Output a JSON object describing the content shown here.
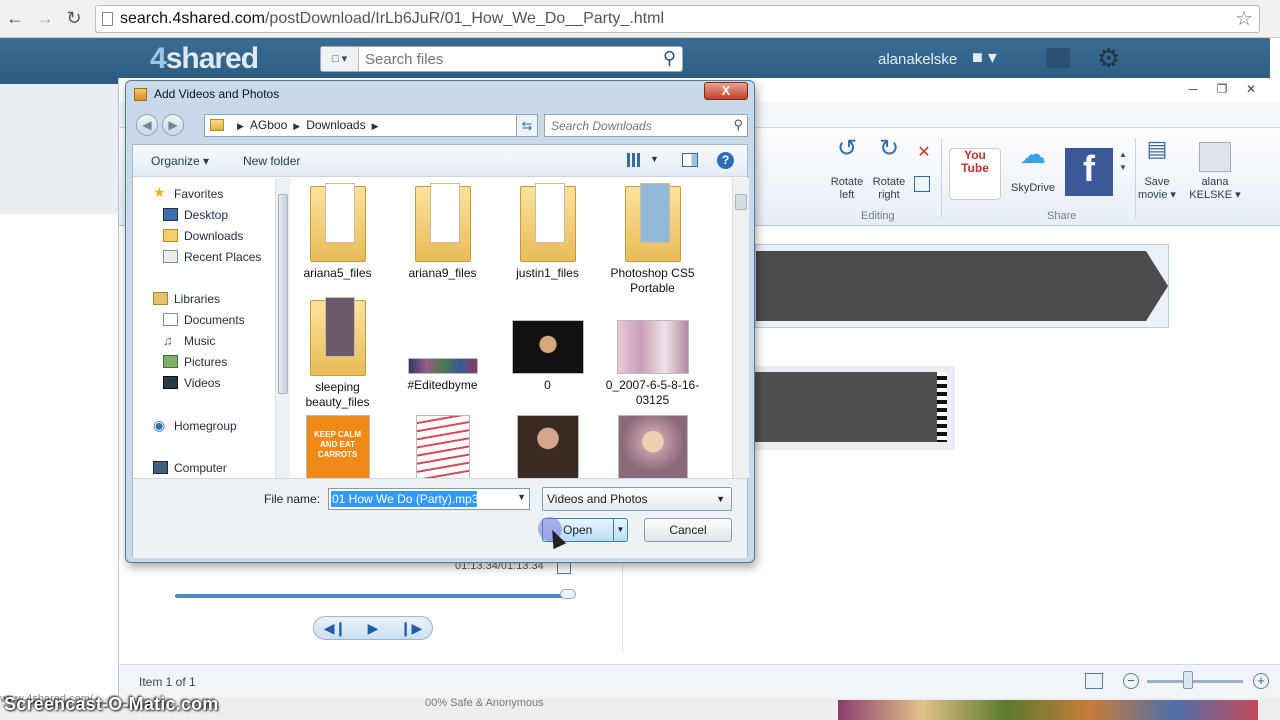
{
  "browser": {
    "url_host": "search.4shared.com",
    "url_path": "/postDownload/IrLb6JuR/01_How_We_Do__Party_.html",
    "back_icon": "back-arrow-icon",
    "forward_icon": "forward-arrow-icon",
    "reload_icon": "reload-icon"
  },
  "site": {
    "logo_num": "4",
    "logo_text": "shared",
    "search_placeholder": "Search files",
    "username": "alanakelske"
  },
  "movie_maker": {
    "ribbon": {
      "rotate_left": "Rotate left",
      "rotate_right": "Rotate right",
      "editing_label": "Editing",
      "youtube": "You Tube",
      "skydrive": "SkyDrive",
      "share_label": "Share",
      "save_movie": "Save movie",
      "user_label": "alana KELSKE"
    },
    "time": "01:13.34/01:13.34",
    "status": "Item 1 of 1"
  },
  "dialog": {
    "title": "Add Videos and Photos",
    "close_label": "X",
    "breadcrumb": [
      "AGboo",
      "Downloads"
    ],
    "search_placeholder": "Search Downloads",
    "toolbar": {
      "organize": "Organize",
      "new_folder": "New folder"
    },
    "nav": {
      "favorites": "Favorites",
      "desktop": "Desktop",
      "downloads": "Downloads",
      "recent_places": "Recent Places",
      "libraries": "Libraries",
      "documents": "Documents",
      "music": "Music",
      "pictures": "Pictures",
      "videos": "Videos",
      "homegroup": "Homegroup",
      "computer": "Computer"
    },
    "files": [
      {
        "name": "ariana5_files",
        "kind": "folder"
      },
      {
        "name": "ariana9_files",
        "kind": "folder"
      },
      {
        "name": "justin1_files",
        "kind": "folder"
      },
      {
        "name": "Photoshop CS5 Portable",
        "kind": "folder"
      },
      {
        "name": "sleeping beauty_files",
        "kind": "folder"
      },
      {
        "name": "#Editedbyme",
        "kind": "image"
      },
      {
        "name": "0",
        "kind": "image"
      },
      {
        "name": "0_2007-6-5-8-16-03125",
        "kind": "image"
      },
      {
        "name": "",
        "kind": "image"
      },
      {
        "name": "",
        "kind": "image"
      },
      {
        "name": "",
        "kind": "image"
      },
      {
        "name": "",
        "kind": "image"
      }
    ],
    "keep_calm_text": "KEEP CALM AND EAT CARROTS",
    "filename_label": "File name:",
    "filename_value": "01 How We Do (Party).mp3",
    "filetype": "Videos and Photos",
    "open_label": "Open",
    "cancel_label": "Cancel"
  },
  "watermark": "Screencast-O-Matic.com",
  "page_footer_note": "00% Safe & Anonymous",
  "page_bottom_text": "www.4shared.com/"
}
